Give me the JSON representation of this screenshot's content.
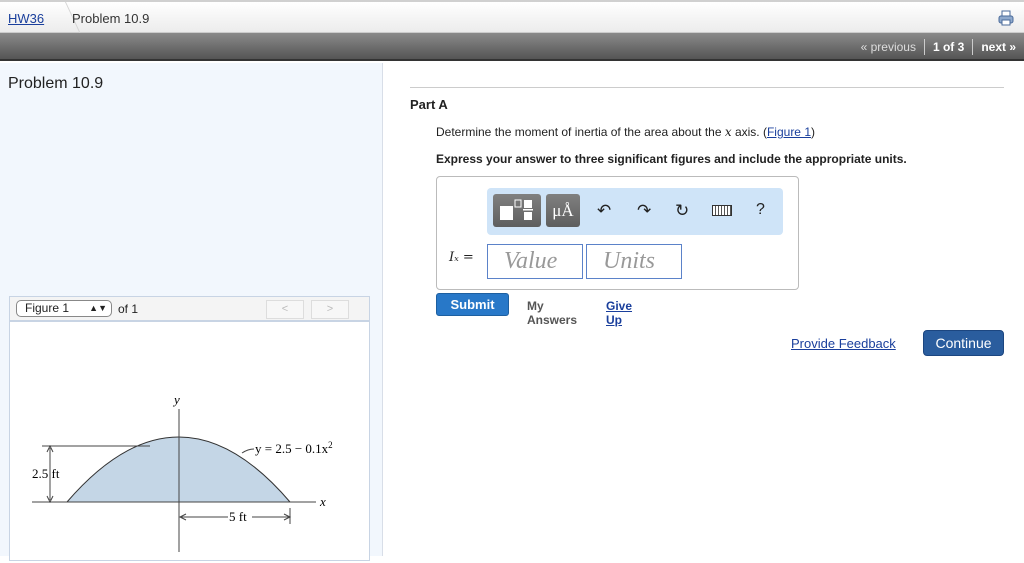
{
  "breadcrumb": {
    "assignment": "HW36",
    "current": "Problem 10.9"
  },
  "pager": {
    "previous": "« previous",
    "position": "1 of 3",
    "next": "next »"
  },
  "left": {
    "title": "Problem 10.9",
    "figure_select": "Figure 1",
    "of": "of 1",
    "prev": "<",
    "next": ">"
  },
  "figure": {
    "y_axis": "y",
    "x_axis": "x",
    "equation": "y = 2.5 − 0.1x",
    "exp": "2",
    "height_label": "2.5 ft",
    "width_label": "5 ft"
  },
  "part": {
    "title": "Part A",
    "question_pre": "Determine the moment of inertia of the area about the ",
    "question_var": "x",
    "question_post": " axis. (",
    "figure_link": "Figure 1",
    "question_end": ")",
    "instruction": "Express your answer to three significant figures and include the appropriate units."
  },
  "toolbar": {
    "units_btn": "μÅ",
    "help": "?"
  },
  "answer": {
    "label": "Iₓ =",
    "value_placeholder": "Value",
    "units_placeholder": "Units"
  },
  "actions": {
    "submit": "Submit",
    "my_answers": "My Answers",
    "give_up": "Give Up",
    "feedback": "Provide Feedback",
    "continue": "Continue"
  }
}
